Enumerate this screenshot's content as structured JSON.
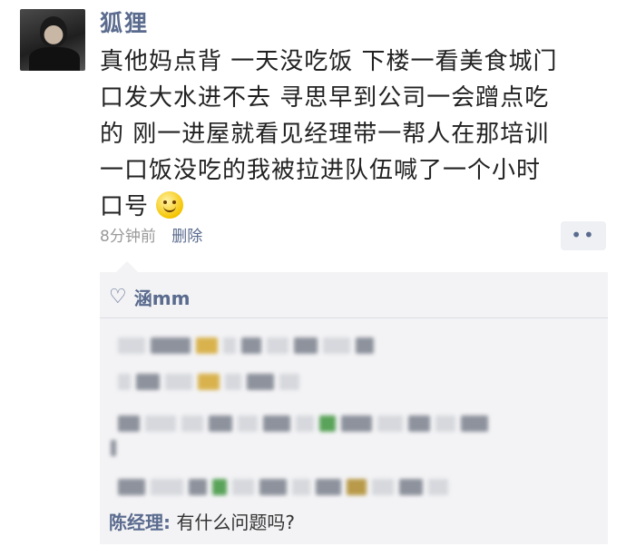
{
  "post": {
    "username": "狐狸",
    "lines": [
      "真他妈点背 一天没吃饭 下楼一看美食城门",
      "口发大水进不去 寻思早到公司一会蹭点吃",
      "的 刚一进屋就看见经理带一帮人在那培训",
      "一口饭没吃的我被拉进队伍喊了一个小时",
      "口号"
    ],
    "time": "8分钟前",
    "delete_label": "删除",
    "more_label": "••"
  },
  "comments": {
    "likes_name": "涵mm",
    "last_comment_name": "陈经理:",
    "last_comment_text": " 有什么问题吗?"
  }
}
